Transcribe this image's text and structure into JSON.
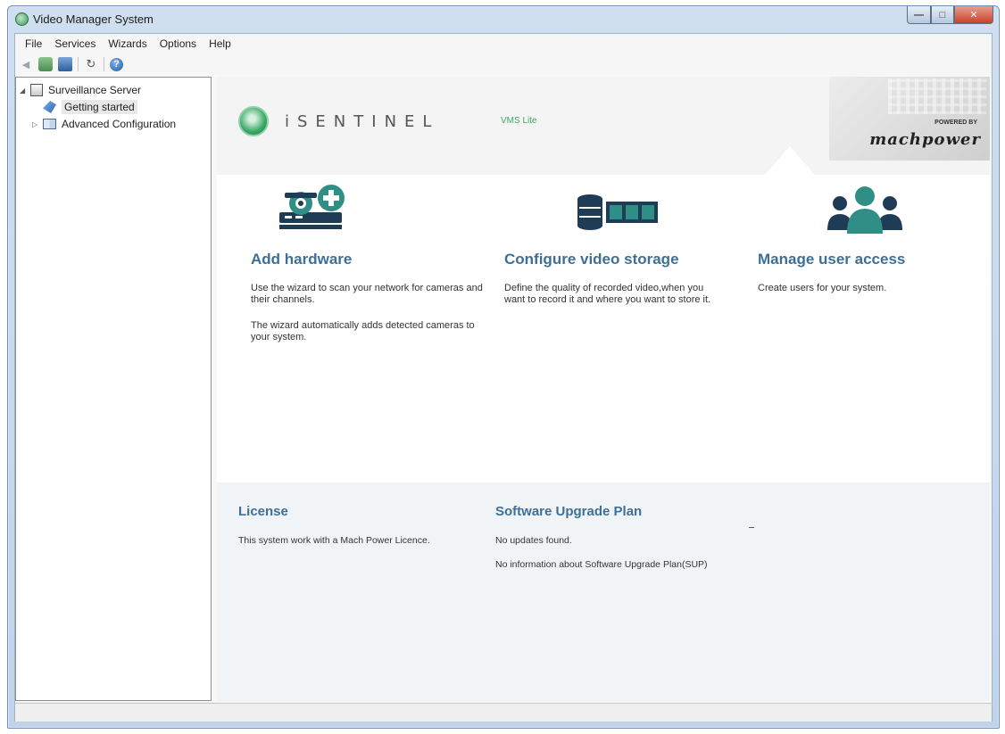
{
  "window": {
    "title": "Video Manager System"
  },
  "menu": [
    "File",
    "Services",
    "Wizards",
    "Options",
    "Help"
  ],
  "toolbar": {
    "icons": [
      "back-icon",
      "users-icon",
      "save-icon",
      "refresh-icon",
      "help-icon"
    ],
    "help_glyph": "?"
  },
  "tree": {
    "root": "Surveillance Server",
    "selected": "Getting started",
    "child2": "Advanced Configuration"
  },
  "brand": {
    "name": "iSENTINEL",
    "sub": "VMS Lite",
    "powered_by": "POWERED BY",
    "partner": "machpower"
  },
  "tasks": [
    {
      "title": "Add hardware",
      "desc1": "Use the wizard to scan your network for cameras and their channels.",
      "desc2": "The wizard automatically adds detected cameras to your system."
    },
    {
      "title": "Configure video storage",
      "desc1": "Define the quality of recorded video,when you want to record it and where you want to store it."
    },
    {
      "title": "Manage user access",
      "desc1": "Create users for your system."
    }
  ],
  "license": {
    "title": "License",
    "desc": "This system work with a Mach Power Licence."
  },
  "sup": {
    "title": "Software Upgrade Plan",
    "desc1": "No updates found.",
    "desc2": "No information about Software Upgrade Plan(SUP)"
  },
  "colors": {
    "accent_blue": "#3e6f96",
    "brand_green": "#41a566",
    "icon_teal": "#2f8f86",
    "icon_navy": "#1f3c56"
  }
}
